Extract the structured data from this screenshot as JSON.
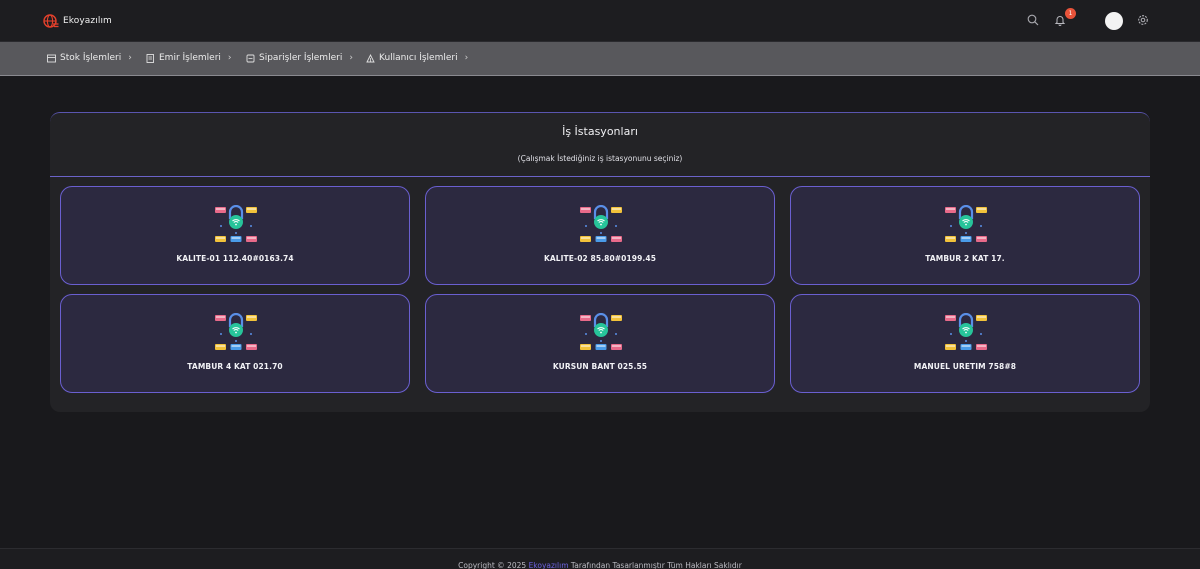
{
  "app": {
    "brand_name": "Ekoyazılım",
    "notification_count": "1",
    "accent_color": "#6a5fd0",
    "badge_color": "#e8533a"
  },
  "topbar": {
    "icons": [
      "search-icon",
      "bell-icon",
      "avatar",
      "gear-icon"
    ]
  },
  "nav": {
    "items": [
      {
        "label": "Stok İşlemleri",
        "icon": "box-icon"
      },
      {
        "label": "Emir İşlemleri",
        "icon": "document-icon"
      },
      {
        "label": "Siparişler İşlemleri",
        "icon": "cart-icon"
      },
      {
        "label": "Kullanıcı İşlemleri",
        "icon": "users-icon"
      }
    ]
  },
  "panel": {
    "title": "İş İstasyonları",
    "subtitle": "(Çalışmak İstediğiniz iş istasyonunu seçiniz)"
  },
  "stations": [
    {
      "label": "KALITE-01 112.40#0163.74"
    },
    {
      "label": "KALITE-02 85.80#0199.45"
    },
    {
      "label": "TAMBUR 2 KAT 17."
    },
    {
      "label": "TAMBUR 4 KAT 021.70"
    },
    {
      "label": "KURSUN BANT 025.55"
    },
    {
      "label": "MANUEL URETIM 758#8"
    }
  ],
  "footer": {
    "prefix": "Copyright © 2025",
    "brand": "Ekoyazılım",
    "suffix": "Tarafından Tasarlanmıştır Tüm Hakları Saklıdır"
  }
}
